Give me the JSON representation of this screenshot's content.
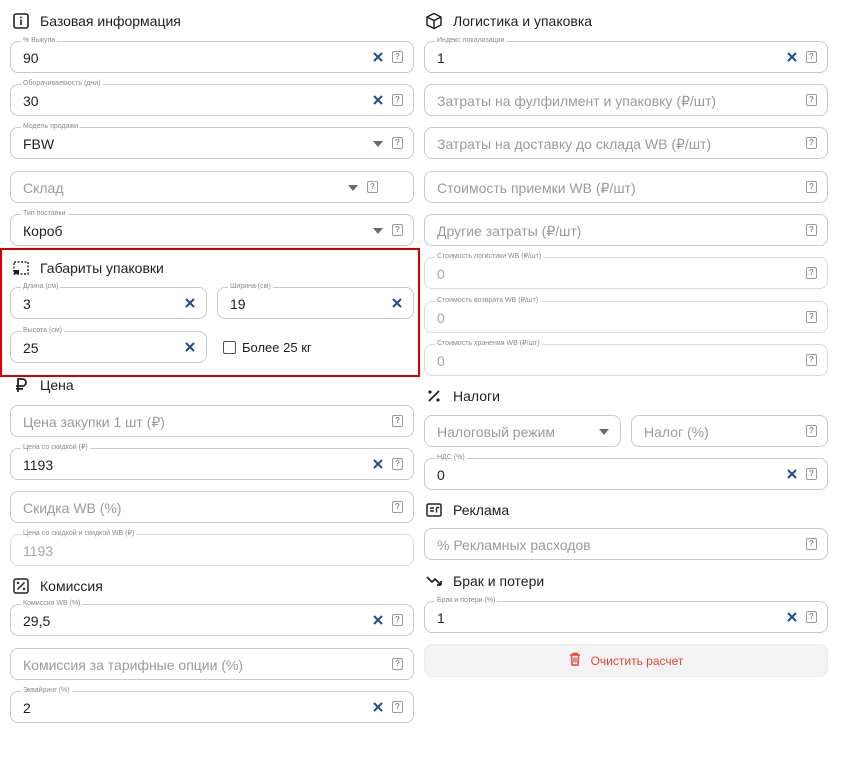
{
  "colors": {
    "accent": "#1f4e8c",
    "danger": "#d40000",
    "danger_text": "#e0463a"
  },
  "sections": {
    "basic": {
      "title": "Базовая информация",
      "icon": "info-icon"
    },
    "dimensions": {
      "title": "Габариты упаковки",
      "icon": "box-dimensions-icon"
    },
    "price": {
      "title": "Цена",
      "icon": "ruble-icon"
    },
    "commission": {
      "title": "Комиссия",
      "icon": "percent-box-icon"
    },
    "logistics": {
      "title": "Логистика и упаковка",
      "icon": "package-icon"
    },
    "taxes": {
      "title": "Налоги",
      "icon": "percent-icon"
    },
    "ads": {
      "title": "Реклама",
      "icon": "ad-icon"
    },
    "defects": {
      "title": "Брак и потери",
      "icon": "trend-down-icon"
    }
  },
  "fields": {
    "buyout": {
      "label": "% Выкупа",
      "value": "90"
    },
    "turnover": {
      "label": "Оборачиваемость (дни)",
      "value": "30"
    },
    "sale_model": {
      "label": "Модель продажи",
      "value": "FBW"
    },
    "warehouse": {
      "placeholder": "Склад"
    },
    "supply_type": {
      "label": "Тип поставки",
      "value": "Короб"
    },
    "length": {
      "label": "Длина (см)",
      "value": "3"
    },
    "width": {
      "label": "Ширина (см)",
      "value": "19"
    },
    "height": {
      "label": "Высота (см)",
      "value": "25"
    },
    "over25": {
      "label": "Более 25 кг"
    },
    "purchase_price": {
      "placeholder": "Цена закупки 1 шт (₽)"
    },
    "discount_price": {
      "label": "Цена со скидкой (₽)",
      "value": "1193"
    },
    "wb_discount": {
      "placeholder": "Скидка WB (%)"
    },
    "price_with_wb": {
      "label": "Цена со скидкой и скидкой WB (₽)",
      "value": "1193"
    },
    "commission_wb": {
      "label": "Комиссия WB (%)",
      "value": "29,5"
    },
    "tariff_commission": {
      "placeholder": "Комиссия за тарифные опции (%)"
    },
    "acquiring": {
      "label": "Эквайринг (%)",
      "value": "2"
    },
    "localization": {
      "label": "Индекс локализации",
      "value": "1"
    },
    "fulfillment": {
      "placeholder": "Затраты на фулфилмент и упаковку (₽/шт)"
    },
    "delivery": {
      "placeholder": "Затраты на доставку до склада WB (₽/шт)"
    },
    "acceptance": {
      "placeholder": "Стоимость приемки WB (₽/шт)"
    },
    "other_costs": {
      "placeholder": "Другие затраты (₽/шт)"
    },
    "logistics_cost": {
      "label": "Стоимость логистики WB (₽/шт)",
      "value": "0"
    },
    "return_cost": {
      "label": "Стоимость возврата WB (₽/шт)",
      "value": "0"
    },
    "storage_cost": {
      "label": "Стоимость хранения WB (₽/шт)",
      "value": "0"
    },
    "tax_mode": {
      "placeholder": "Налоговый режим"
    },
    "tax": {
      "placeholder": "Налог (%)"
    },
    "vat": {
      "label": "НДС (%)",
      "value": "0"
    },
    "ad_spend": {
      "placeholder": "% Рекламных расходов"
    },
    "defects": {
      "label": "Брак и потери (%)",
      "value": "1"
    }
  },
  "actions": {
    "clear_calc": "Очистить расчет"
  },
  "help_glyph": "?"
}
